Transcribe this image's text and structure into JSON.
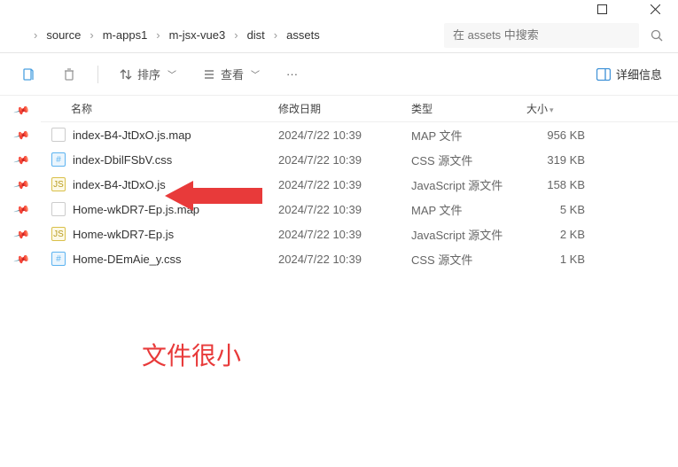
{
  "window": {
    "minimize": "–",
    "maximize": "☐",
    "close": "✕"
  },
  "breadcrumb": {
    "items": [
      "source",
      "m-apps1",
      "m-jsx-vue3",
      "dist",
      "assets"
    ]
  },
  "search": {
    "placeholder": "在 assets 中搜索"
  },
  "toolbar": {
    "sort": "排序",
    "view": "查看",
    "more": "···",
    "details": "详细信息"
  },
  "columns": {
    "name": "名称",
    "date": "修改日期",
    "type": "类型",
    "size": "大小"
  },
  "files": [
    {
      "icon": "map",
      "name": "index-B4-JtDxO.js.map",
      "date": "2024/7/22 10:39",
      "type": "MAP 文件",
      "size": "956 KB"
    },
    {
      "icon": "css",
      "name": "index-DbilFSbV.css",
      "date": "2024/7/22 10:39",
      "type": "CSS 源文件",
      "size": "319 KB"
    },
    {
      "icon": "js",
      "name": "index-B4-JtDxO.js",
      "date": "2024/7/22 10:39",
      "type": "JavaScript 源文件",
      "size": "158 KB"
    },
    {
      "icon": "map",
      "name": "Home-wkDR7-Ep.js.map",
      "date": "2024/7/22 10:39",
      "type": "MAP 文件",
      "size": "5 KB"
    },
    {
      "icon": "js",
      "name": "Home-wkDR7-Ep.js",
      "date": "2024/7/22 10:39",
      "type": "JavaScript 源文件",
      "size": "2 KB"
    },
    {
      "icon": "css",
      "name": "Home-DEmAie_y.css",
      "date": "2024/7/22 10:39",
      "type": "CSS 源文件",
      "size": "1 KB"
    }
  ],
  "annotation": {
    "text": "文件很小",
    "color": "#e83a3a"
  }
}
